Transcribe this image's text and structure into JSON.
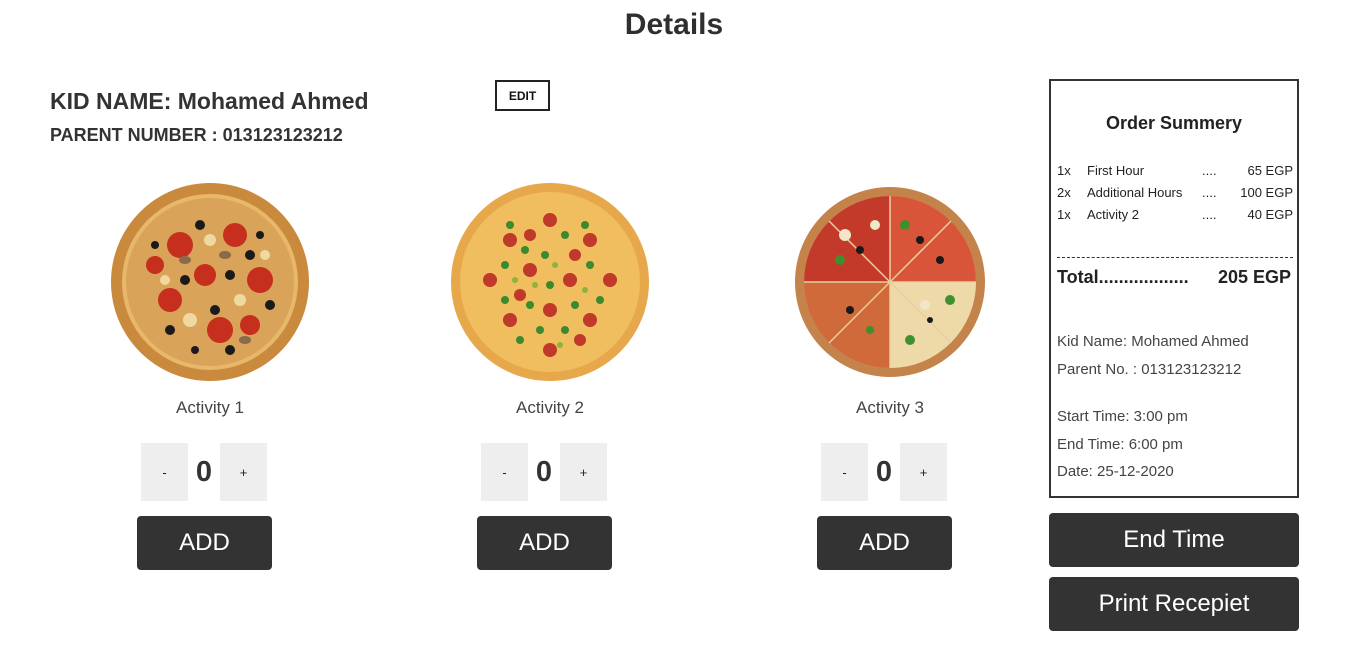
{
  "page": {
    "title": "Details"
  },
  "kid": {
    "name_line": "KID NAME: Mohamed Ahmed",
    "parent_line": "PARENT NUMBER : 013123123212",
    "edit_label": "EDIT"
  },
  "activities": [
    {
      "label": "Activity 1",
      "quantity": "0",
      "minus": "-",
      "plus": "+",
      "add_label": "ADD",
      "image": "pizza-olive-tomato"
    },
    {
      "label": "Activity 2",
      "quantity": "0",
      "minus": "-",
      "plus": "+",
      "add_label": "ADD",
      "image": "pizza-pepperoni-herb"
    },
    {
      "label": "Activity 3",
      "quantity": "0",
      "minus": "-",
      "plus": "+",
      "add_label": "ADD",
      "image": "pizza-mixed-slices"
    }
  ],
  "summary": {
    "title": "Order Summery",
    "items": [
      {
        "qty": "1x",
        "name": "First Hour",
        "dots": "....",
        "price": "65 EGP"
      },
      {
        "qty": "2x",
        "name": "Additional Hours",
        "dots": "....",
        "price": "100 EGP"
      },
      {
        "qty": "1x",
        "name": "Activity 2",
        "dots": "....",
        "price": "40 EGP"
      }
    ],
    "total_label": "Total..................",
    "total_value": "205 EGP",
    "kid_name": "Kid Name: Mohamed Ahmed",
    "parent_no": "Parent No. : 013123123212",
    "start_time": "Start Time: 3:00 pm",
    "end_time": "End Time: 6:00 pm",
    "date": "Date: 25-12-2020"
  },
  "actions": {
    "end_time_label": "End Time",
    "print_label": "Print Recepiet"
  },
  "colors": {
    "button_dark": "#333333",
    "stepper_bg": "#eeeeee",
    "text": "#333333"
  }
}
